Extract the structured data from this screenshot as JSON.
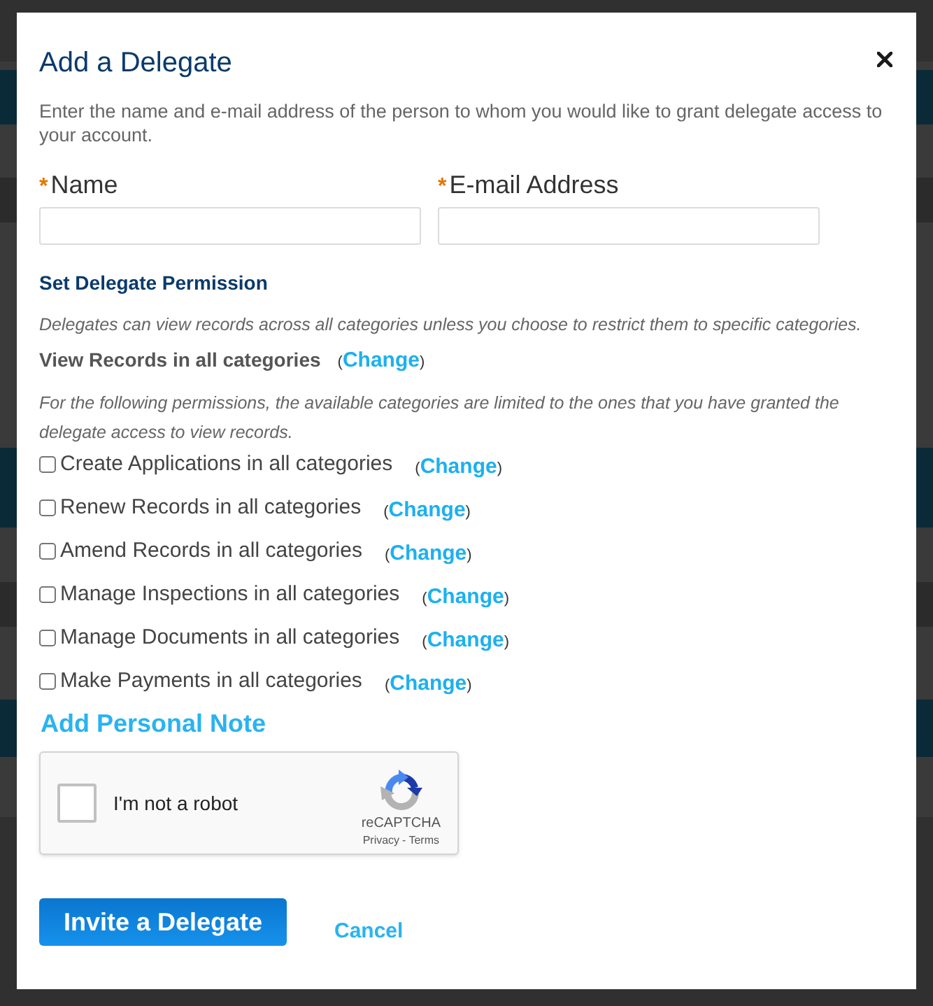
{
  "dialog": {
    "title": "Add a Delegate",
    "intro": "Enter the name and e-mail address of the person to whom you would like to grant delegate access to your account."
  },
  "fields": [
    {
      "required_mark": "*",
      "label": "Name"
    },
    {
      "required_mark": "*",
      "label": "E-mail Address"
    }
  ],
  "permissions": {
    "heading": "Set Delegate Permission",
    "view_note": "Delegates can view records across all categories unless you choose to restrict them to specific categories.",
    "view": {
      "label": "View Records in all categories",
      "link": {
        "open": "(",
        "text": "Change",
        "close": ")"
      }
    },
    "limit_note": "For the following permissions, the available categories are limited to the ones that you have granted the delegate access to view records.",
    "items": [
      {
        "label": "Create Applications in all categories",
        "checked": false,
        "link": {
          "open": "(",
          "text": "Change",
          "close": ")"
        }
      },
      {
        "label": "Renew Records in all categories",
        "checked": false,
        "link": {
          "open": "(",
          "text": "Change",
          "close": ")"
        }
      },
      {
        "label": "Amend Records in all categories",
        "checked": false,
        "link": {
          "open": "(",
          "text": "Change",
          "close": ")"
        }
      },
      {
        "label": "Manage Inspections in all categories",
        "checked": false,
        "link": {
          "open": "(",
          "text": "Change",
          "close": ")"
        }
      },
      {
        "label": "Manage Documents in all categories",
        "checked": false,
        "link": {
          "open": "(",
          "text": "Change",
          "close": ")"
        }
      },
      {
        "label": "Make Payments in all categories",
        "checked": false,
        "link": {
          "open": "(",
          "text": "Change",
          "close": ")"
        }
      }
    ]
  },
  "personal_note_link": "Add Personal Note",
  "captcha": {
    "checked": false,
    "label": "I'm not a robot",
    "brand": "reCAPTCHA",
    "links": [
      "Privacy",
      "Terms"
    ],
    "separator": "-"
  },
  "actions": {
    "submit": "Invite a Delegate",
    "cancel": "Cancel"
  }
}
